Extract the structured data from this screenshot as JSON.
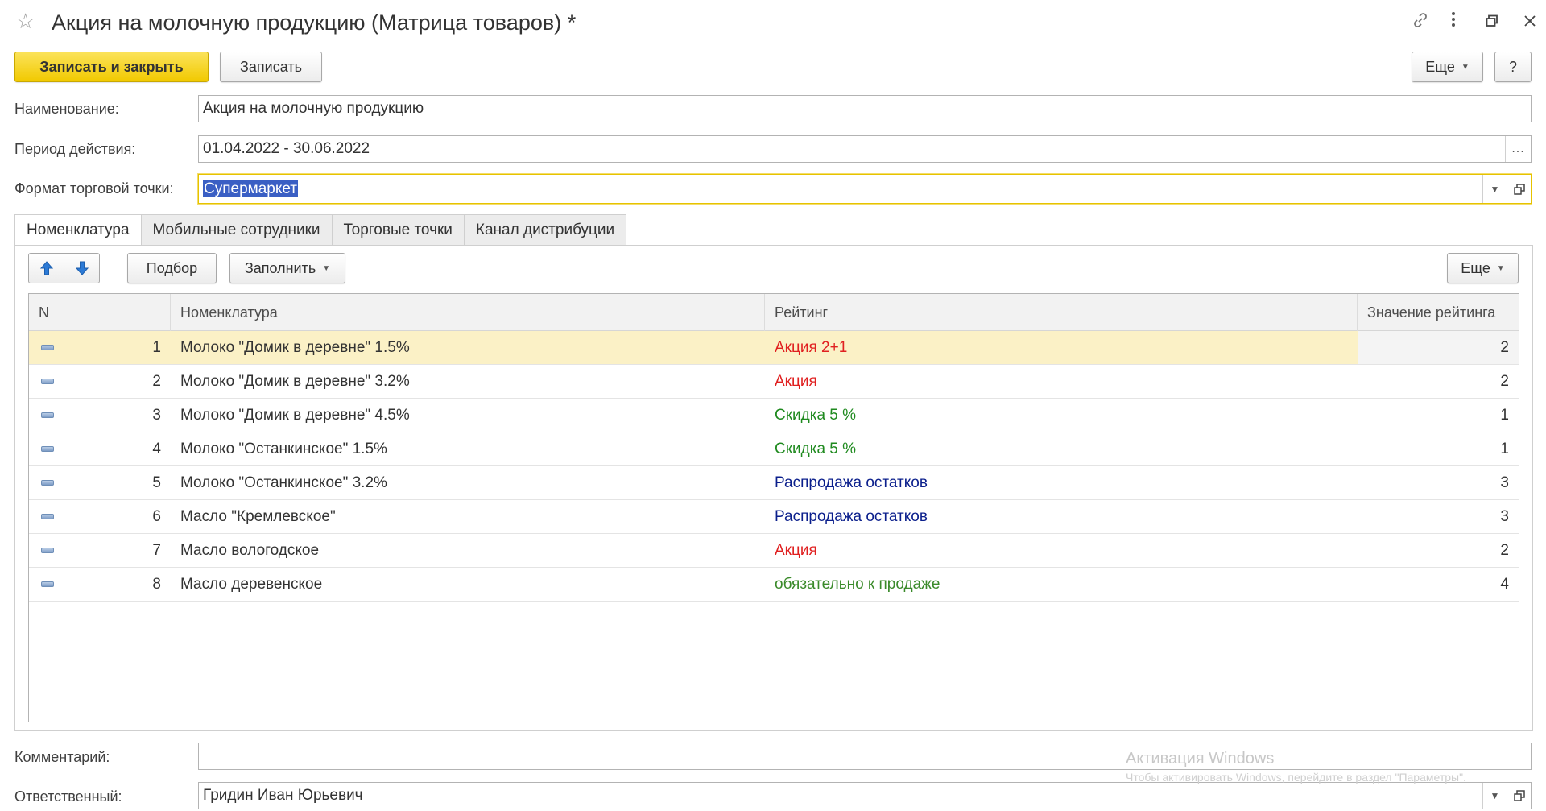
{
  "window": {
    "title": "Акция на молочную продукцию (Матрица товаров) *"
  },
  "toolbar": {
    "save_close_label": "Записать и закрыть",
    "save_label": "Записать",
    "more_label": "Еще",
    "help_label": "?"
  },
  "form": {
    "name_label": "Наименование:",
    "name_value": "Акция на молочную продукцию",
    "period_label": "Период действия:",
    "period_value": "01.04.2022 - 30.06.2022",
    "format_label": "Формат торговой точки:",
    "format_value": "Супермаркет",
    "comment_label": "Комментарий:",
    "comment_value": "",
    "responsible_label": "Ответственный:",
    "responsible_value": "Гридин Иван Юрьевич"
  },
  "tabs": [
    {
      "label": "Номенклатура"
    },
    {
      "label": "Мобильные сотрудники"
    },
    {
      "label": "Торговые точки"
    },
    {
      "label": "Канал дистрибуции"
    }
  ],
  "table_toolbar": {
    "select_label": "Подбор",
    "fill_label": "Заполнить",
    "more_label": "Еще"
  },
  "table": {
    "columns": [
      "N",
      "Номенклатура",
      "Рейтинг",
      "Значение рейтинга"
    ],
    "rows": [
      {
        "n": "1",
        "product": "Молоко \"Домик в деревне\" 1.5%",
        "rating": "Акция 2+1",
        "rating_color": "#e02020",
        "value": "2"
      },
      {
        "n": "2",
        "product": "Молоко \"Домик в деревне\" 3.2%",
        "rating": "Акция",
        "rating_color": "#e02020",
        "value": "2"
      },
      {
        "n": "3",
        "product": "Молоко \"Домик в деревне\" 4.5%",
        "rating": "Скидка 5 %",
        "rating_color": "#1f8a1f",
        "value": "1"
      },
      {
        "n": "4",
        "product": "Молоко \"Останкинское\" 1.5%",
        "rating": "Скидка 5 %",
        "rating_color": "#1f8a1f",
        "value": "1"
      },
      {
        "n": "5",
        "product": "Молоко \"Останкинское\" 3.2%",
        "rating": "Распродажа остатков",
        "rating_color": "#0b1f8c",
        "value": "3"
      },
      {
        "n": "6",
        "product": "Масло \"Кремлевское\"",
        "rating": "Распродажа остатков",
        "rating_color": "#0b1f8c",
        "value": "3"
      },
      {
        "n": "7",
        "product": "Масло вологодское",
        "rating": "Акция",
        "rating_color": "#e02020",
        "value": "2"
      },
      {
        "n": "8",
        "product": "Масло деревенское",
        "rating": "обязательно к продаже",
        "rating_color": "#3a8a2a",
        "value": "4"
      }
    ]
  },
  "watermark": {
    "line1": "Активация Windows",
    "line2": "Чтобы активировать Windows, перейдите в раздел \"Параметры\"."
  },
  "colors": {
    "primary_button": "#f1c900",
    "selection_row": "#fbf1c6",
    "text_selection": "#3a5fc4"
  }
}
